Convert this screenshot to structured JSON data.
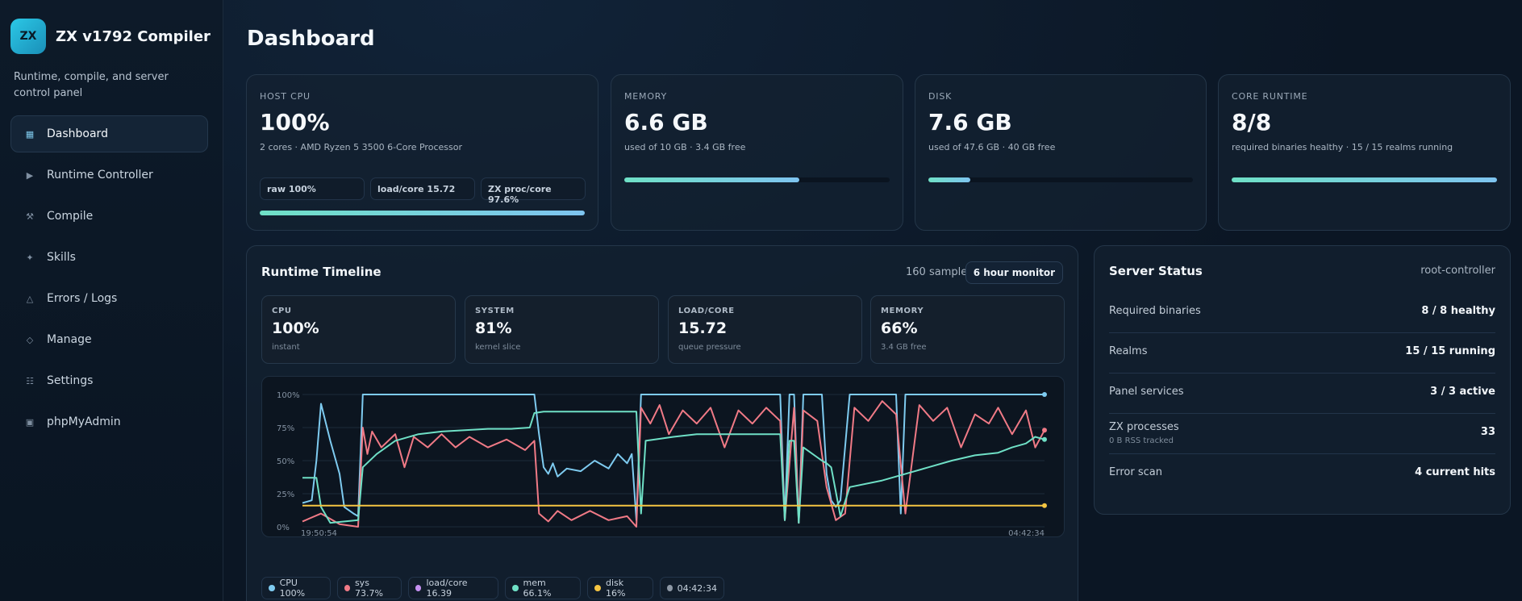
{
  "brand": {
    "logo": "ZX",
    "title": "ZX v1792 Compiler",
    "subtitle": "Runtime, compile, and server control panel"
  },
  "nav": [
    {
      "label": "Dashboard",
      "icon": "grid-icon",
      "glyph": "▦",
      "active": true
    },
    {
      "label": "Runtime Controller",
      "icon": "play-icon",
      "glyph": "▶",
      "active": false
    },
    {
      "label": "Compile",
      "icon": "tools-icon",
      "glyph": "⚒",
      "active": false
    },
    {
      "label": "Skills",
      "icon": "sparkle-icon",
      "glyph": "✦",
      "active": false
    },
    {
      "label": "Errors / Logs",
      "icon": "warning-icon",
      "glyph": "△",
      "active": false
    },
    {
      "label": "Manage",
      "icon": "diamond-icon",
      "glyph": "◇",
      "active": false
    },
    {
      "label": "Settings",
      "icon": "list-icon",
      "glyph": "☷",
      "active": false
    },
    {
      "label": "phpMyAdmin",
      "icon": "database-icon",
      "glyph": "▣",
      "active": false
    }
  ],
  "page": {
    "title": "Dashboard"
  },
  "stats": {
    "cpu": {
      "label": "HOST CPU",
      "value": "100%",
      "sub": "2 cores · AMD Ryzen 5 3500 6-Core Processor",
      "chips": [
        "raw 100%",
        "load/core 15.72",
        "ZX proc/core 97.6%"
      ],
      "fill": 1.0
    },
    "memory": {
      "label": "MEMORY",
      "value": "6.6 GB",
      "sub": "used of 10 GB · 3.4 GB free",
      "fill": 0.66
    },
    "disk": {
      "label": "DISK",
      "value": "7.6 GB",
      "sub": "used of 47.6 GB · 40 GB free",
      "fill": 0.16
    },
    "runtime": {
      "label": "CORE RUNTIME",
      "value": "8/8",
      "sub": "required binaries healthy · 15 / 15 realms running",
      "fill": 1.0
    }
  },
  "timeline": {
    "title": "Runtime Timeline",
    "samples": "160 samples",
    "monitor": "6 hour monitor",
    "mini": [
      {
        "label": "CPU",
        "value": "100%",
        "sub": "instant"
      },
      {
        "label": "SYSTEM",
        "value": "81%",
        "sub": "kernel slice"
      },
      {
        "label": "LOAD/CORE",
        "value": "15.72",
        "sub": "queue pressure"
      },
      {
        "label": "MEMORY",
        "value": "66%",
        "sub": "3.4 GB free"
      }
    ],
    "legend": [
      {
        "label": "CPU 100%",
        "color": "#7ecbf0"
      },
      {
        "label": "sys 73.7%",
        "color": "#f07a86"
      },
      {
        "label": "load/core 16.39",
        "color": "#c490f0"
      },
      {
        "label": "mem 66.1%",
        "color": "#6fe0c6"
      },
      {
        "label": "disk 16%",
        "color": "#f5c542"
      },
      {
        "label": "04:42:34",
        "color": "#8d98a5"
      }
    ]
  },
  "chart_data": {
    "type": "line",
    "x_start": "19:50:54",
    "x_end": "04:42:34",
    "y_ticks": [
      "100%",
      "75%",
      "50%",
      "25%",
      "0%"
    ],
    "ylim": [
      0,
      100
    ],
    "grid": true,
    "series": [
      {
        "name": "CPU",
        "color": "#7ecbf0",
        "points": [
          [
            0,
            18
          ],
          [
            2,
            20
          ],
          [
            3,
            50
          ],
          [
            4,
            93
          ],
          [
            6,
            65
          ],
          [
            8,
            40
          ],
          [
            9,
            15
          ],
          [
            11,
            10
          ],
          [
            12,
            8
          ],
          [
            13,
            100
          ],
          [
            50,
            100
          ],
          [
            51,
            70
          ],
          [
            52,
            45
          ],
          [
            53,
            40
          ],
          [
            54,
            48
          ],
          [
            55,
            38
          ],
          [
            57,
            44
          ],
          [
            60,
            42
          ],
          [
            63,
            50
          ],
          [
            66,
            44
          ],
          [
            68,
            55
          ],
          [
            70,
            48
          ],
          [
            71,
            55
          ],
          [
            72,
            5
          ],
          [
            73,
            100
          ],
          [
            103,
            100
          ],
          [
            104,
            5
          ],
          [
            105,
            100
          ],
          [
            106,
            100
          ],
          [
            107,
            3
          ],
          [
            108,
            100
          ],
          [
            112,
            100
          ],
          [
            113,
            40
          ],
          [
            114,
            20
          ],
          [
            115,
            15
          ],
          [
            116,
            20
          ],
          [
            118,
            100
          ],
          [
            128,
            100
          ],
          [
            129,
            10
          ],
          [
            130,
            100
          ],
          [
            160,
            100
          ]
        ]
      },
      {
        "name": "sys",
        "color": "#f07a86",
        "points": [
          [
            0,
            4
          ],
          [
            4,
            10
          ],
          [
            8,
            2
          ],
          [
            12,
            0
          ],
          [
            13,
            75
          ],
          [
            14,
            55
          ],
          [
            15,
            72
          ],
          [
            17,
            60
          ],
          [
            20,
            70
          ],
          [
            22,
            45
          ],
          [
            24,
            68
          ],
          [
            27,
            60
          ],
          [
            30,
            70
          ],
          [
            33,
            60
          ],
          [
            36,
            68
          ],
          [
            40,
            60
          ],
          [
            44,
            66
          ],
          [
            48,
            58
          ],
          [
            50,
            65
          ],
          [
            51,
            10
          ],
          [
            53,
            4
          ],
          [
            55,
            12
          ],
          [
            58,
            5
          ],
          [
            62,
            12
          ],
          [
            66,
            5
          ],
          [
            70,
            8
          ],
          [
            72,
            0
          ],
          [
            73,
            90
          ],
          [
            75,
            78
          ],
          [
            77,
            92
          ],
          [
            79,
            70
          ],
          [
            82,
            88
          ],
          [
            85,
            78
          ],
          [
            88,
            90
          ],
          [
            91,
            60
          ],
          [
            94,
            88
          ],
          [
            97,
            78
          ],
          [
            100,
            90
          ],
          [
            103,
            80
          ],
          [
            104,
            5
          ],
          [
            106,
            90
          ],
          [
            107,
            3
          ],
          [
            108,
            88
          ],
          [
            111,
            80
          ],
          [
            113,
            30
          ],
          [
            115,
            5
          ],
          [
            117,
            10
          ],
          [
            119,
            90
          ],
          [
            122,
            80
          ],
          [
            125,
            95
          ],
          [
            128,
            85
          ],
          [
            130,
            10
          ],
          [
            133,
            92
          ],
          [
            136,
            80
          ],
          [
            139,
            90
          ],
          [
            142,
            60
          ],
          [
            145,
            85
          ],
          [
            148,
            78
          ],
          [
            150,
            90
          ],
          [
            153,
            70
          ],
          [
            156,
            88
          ],
          [
            158,
            60
          ],
          [
            160,
            73
          ]
        ]
      },
      {
        "name": "mem",
        "color": "#6fe0c6",
        "points": [
          [
            0,
            37
          ],
          [
            3,
            37
          ],
          [
            4,
            15
          ],
          [
            6,
            3
          ],
          [
            12,
            5
          ],
          [
            13,
            45
          ],
          [
            16,
            55
          ],
          [
            20,
            65
          ],
          [
            25,
            70
          ],
          [
            30,
            72
          ],
          [
            35,
            73
          ],
          [
            40,
            74
          ],
          [
            45,
            74
          ],
          [
            49,
            75
          ],
          [
            50,
            86
          ],
          [
            52,
            87
          ],
          [
            60,
            87
          ],
          [
            72,
            87
          ],
          [
            73,
            10
          ],
          [
            74,
            65
          ],
          [
            80,
            68
          ],
          [
            85,
            70
          ],
          [
            90,
            70
          ],
          [
            95,
            70
          ],
          [
            103,
            70
          ],
          [
            104,
            5
          ],
          [
            105,
            65
          ],
          [
            106,
            65
          ],
          [
            107,
            3
          ],
          [
            108,
            60
          ],
          [
            112,
            50
          ],
          [
            113,
            48
          ],
          [
            114,
            45
          ],
          [
            116,
            8
          ],
          [
            118,
            30
          ],
          [
            125,
            35
          ],
          [
            130,
            40
          ],
          [
            135,
            45
          ],
          [
            140,
            50
          ],
          [
            145,
            54
          ],
          [
            150,
            56
          ],
          [
            153,
            60
          ],
          [
            156,
            63
          ],
          [
            158,
            68
          ],
          [
            160,
            66
          ]
        ]
      },
      {
        "name": "disk",
        "color": "#f5c542",
        "points": [
          [
            0,
            16
          ],
          [
            160,
            16
          ]
        ]
      }
    ]
  },
  "server": {
    "title": "Server Status",
    "host": "root-controller",
    "rows": [
      {
        "key": "Required binaries",
        "value": "8 / 8 healthy",
        "note": ""
      },
      {
        "key": "Realms",
        "value": "15 / 15 running",
        "note": ""
      },
      {
        "key": "Panel services",
        "value": "3 / 3 active",
        "note": ""
      },
      {
        "key": "ZX processes",
        "value": "33",
        "note": "0 B RSS tracked"
      },
      {
        "key": "Error scan",
        "value": "4 current hits",
        "note": ""
      }
    ]
  }
}
